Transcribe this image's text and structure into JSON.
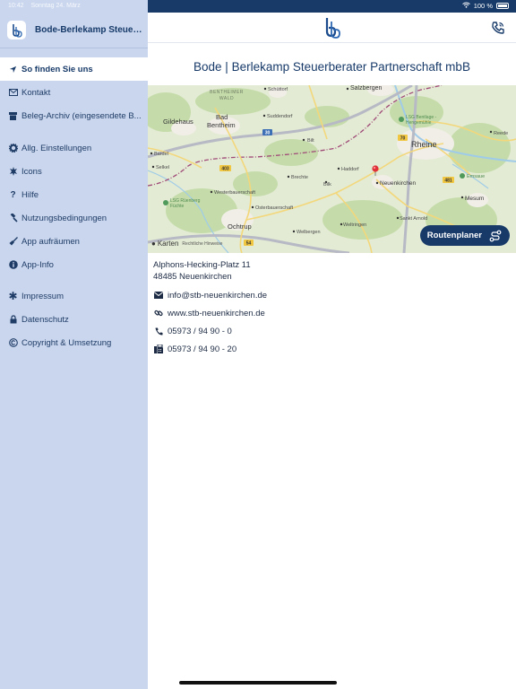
{
  "status_bar": {
    "time": "10:42",
    "date": "Sonntag 24. März",
    "battery": "100 %"
  },
  "sidebar": {
    "app_title": "Bode-Berlekamp Steuer...",
    "items": [
      {
        "label": "So finden Sie uns",
        "icon": "location-arrow-icon",
        "active": true
      },
      {
        "label": "Kontakt",
        "icon": "mail-icon"
      },
      {
        "label": "Beleg-Archiv (eingesendete B...",
        "icon": "archive-box-icon"
      },
      {
        "label": "Allg. Einstellungen",
        "icon": "gear-icon"
      },
      {
        "label": "Icons",
        "icon": "star-burst-icon"
      },
      {
        "label": "Hilfe",
        "icon": "question-icon"
      },
      {
        "label": "Nutzungsbedingungen",
        "icon": "gavel-icon"
      },
      {
        "label": "App aufräumen",
        "icon": "broom-icon"
      },
      {
        "label": "App-Info",
        "icon": "info-icon"
      },
      {
        "label": "Impressum",
        "icon": "asterisk-icon"
      },
      {
        "label": "Datenschutz",
        "icon": "lock-icon"
      },
      {
        "label": "Copyright & Umsetzung",
        "icon": "copyright-icon"
      }
    ]
  },
  "main": {
    "title": "Bode | Berlekamp Steuerberater Partnerschaft mbB",
    "route_button": "Routenplaner",
    "map_attribution": "Karten",
    "map_legal": "Rechtliche Hinweise",
    "map_labels": {
      "schuettorf": "Schüttorf",
      "salzbergen": "Salzbergen",
      "bentheimer_wald_1": "BENTHEIMER",
      "bentheimer_wald_2": "WALD",
      "gildehaus": "Gildehaus",
      "bad": "Bad",
      "bentheim": "Bentheim",
      "suddendorf": "Suddendorf",
      "lsg_bentlage_1": "LSG Bentlage -",
      "lsg_bentlage_2": "Hengemühle",
      "rheine": "Rheine",
      "bardel": "Bardel",
      "selkel": "Selkel",
      "bilk": "Bilk",
      "brechte": "Brechte",
      "haddorf": "Haddorf",
      "neuenkirchen": "Neuenkirchen",
      "emsaue": "Emsaue",
      "mesum": "Mesum",
      "westerbauerschaft": "Westerbauerschaft",
      "osterbauerschaft": "Osterbauerschaft",
      "lsg_ruenberg_1": "LSG Rüenberg",
      "lsg_ruenberg_2": "Füchte",
      "ochtrup": "Ochtrup",
      "weltringen": "Weltringen",
      "sankt_arnold": "Sankt Arnold",
      "welbergen": "Welbergen",
      "reede": "Reede",
      "bilt": "Bilt",
      "road_30": "30",
      "road_403": "403",
      "road_481": "481",
      "road_54": "54",
      "road_70": "70"
    },
    "address_line1": "Alphons-Hecking-Platz 11",
    "address_line2": "48485 Neuenkirchen",
    "email": "info@stb-neuenkirchen.de",
    "website": "www.stb-neuenkirchen.de",
    "phone": "05973 / 94 90 - 0",
    "fax": "05973 / 94 90 - 20"
  },
  "colors": {
    "brand": "#173a69",
    "sidebar_bg": "#c9d6ee",
    "route_button_bg": "#173a69"
  }
}
